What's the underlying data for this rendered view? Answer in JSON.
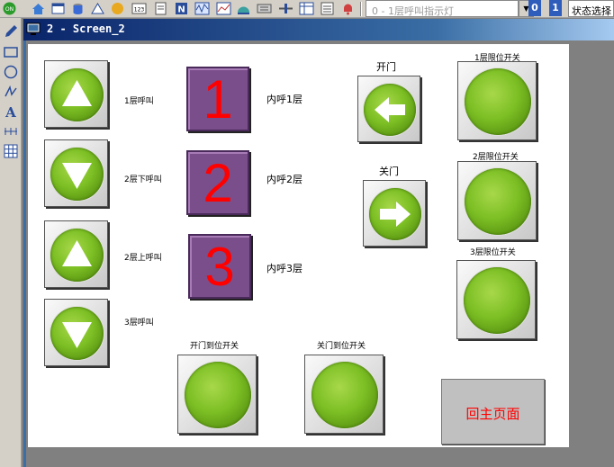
{
  "toolbar": {
    "icons": [
      "on-icon",
      "home-icon",
      "window-icon",
      "drum-icon",
      "triangle-icon",
      "lamp-icon",
      "numeric-icon",
      "document-icon",
      "n-icon",
      "waveform-icon",
      "chart-icon",
      "dome-icon",
      "keypad-icon",
      "slider-icon",
      "table-icon",
      "list-icon",
      "bell-icon"
    ],
    "selector_value": "0 - 1层呼叫指示灯",
    "btn_0": "0",
    "btn_1": "1",
    "status": "状态选择"
  },
  "palette": {
    "tools": [
      "pencil-icon",
      "rectangle-icon",
      "circle-icon",
      "polyline-icon",
      "text-icon",
      "scale-icon",
      "grid-icon"
    ]
  },
  "window": {
    "title": "2 - Screen_2"
  },
  "screen": {
    "call_1": "1层呼叫",
    "call_2_down": "2层下呼叫",
    "call_2_up": "2层上呼叫",
    "call_3": "3层呼叫",
    "num_1": "1",
    "num_2": "2",
    "num_3": "3",
    "inner_1": "内呼1层",
    "inner_2": "内呼2层",
    "inner_3": "内呼3层",
    "open_door": "开门",
    "close_door": "关门",
    "limit_1": "1层限位开关",
    "limit_2": "2层限位开关",
    "limit_3": "3层限位开关",
    "open_limit": "开门到位开关",
    "close_limit": "关门到位开关",
    "return_main": "回主页面"
  },
  "colors": {
    "title_bar": "#0a246a",
    "button_green": "#7cbf24",
    "number_purple": "#7a4e8a",
    "number_red": "#ff0000"
  }
}
